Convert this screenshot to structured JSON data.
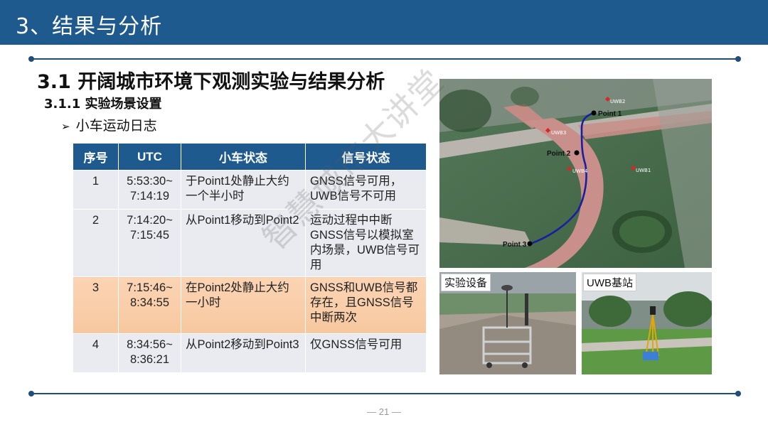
{
  "header": {
    "title": "3、结果与分析"
  },
  "heading1": "3.1 开阔城市环境下观测实验与结果分析",
  "heading2": "3.1.1 实验场景设置",
  "bullet": {
    "marker": "➢",
    "text": "小车运动日志"
  },
  "table": {
    "columns": [
      "序号",
      "UTC",
      "小车状态",
      "信号状态"
    ],
    "rows": [
      {
        "no": "1",
        "utc_start": "5:53:30~",
        "utc_end": "7:14:19",
        "car": "于Point1处静止大约一个半小时",
        "signal": "GNSS信号可用，UWB信号不可用"
      },
      {
        "no": "2",
        "utc_start": "7:14:20~",
        "utc_end": "7:15:45",
        "car": "从Point1移动到Point2",
        "signal": "运动过程中中断GNSS信号以模拟室内场景，UWB信号可用"
      },
      {
        "no": "3",
        "utc_start": "7:15:46~",
        "utc_end": "8:34:55",
        "car": "在Point2处静止大约一小时",
        "signal": "GNSS和UWB信号都存在，且GNSS信号中断两次"
      },
      {
        "no": "4",
        "utc_start": "8:34:56~",
        "utc_end": "8:36:21",
        "car": "从Point2移动到Point3",
        "signal": "仅GNSS信号可用"
      }
    ]
  },
  "map": {
    "points": [
      "Point 1",
      "Point 2",
      "Point 3"
    ],
    "markers": [
      "UWB2",
      "UWB3",
      "UWB4",
      "UWB1"
    ],
    "colors": {
      "grass": "#3f6b3f",
      "path": "#c98a86",
      "trajectory": "#1a1fa0",
      "marker": "#d62828"
    }
  },
  "photos": [
    {
      "label": "实验设备"
    },
    {
      "label": "UWB基站"
    }
  ],
  "watermark": "智慧城市大讲堂",
  "page_number": "— 21 —",
  "colors": {
    "header": "#1f5a8f",
    "table_header": "#1f5a8f",
    "highlight_row": "#f9cfae",
    "rule": "#1f4e79"
  }
}
